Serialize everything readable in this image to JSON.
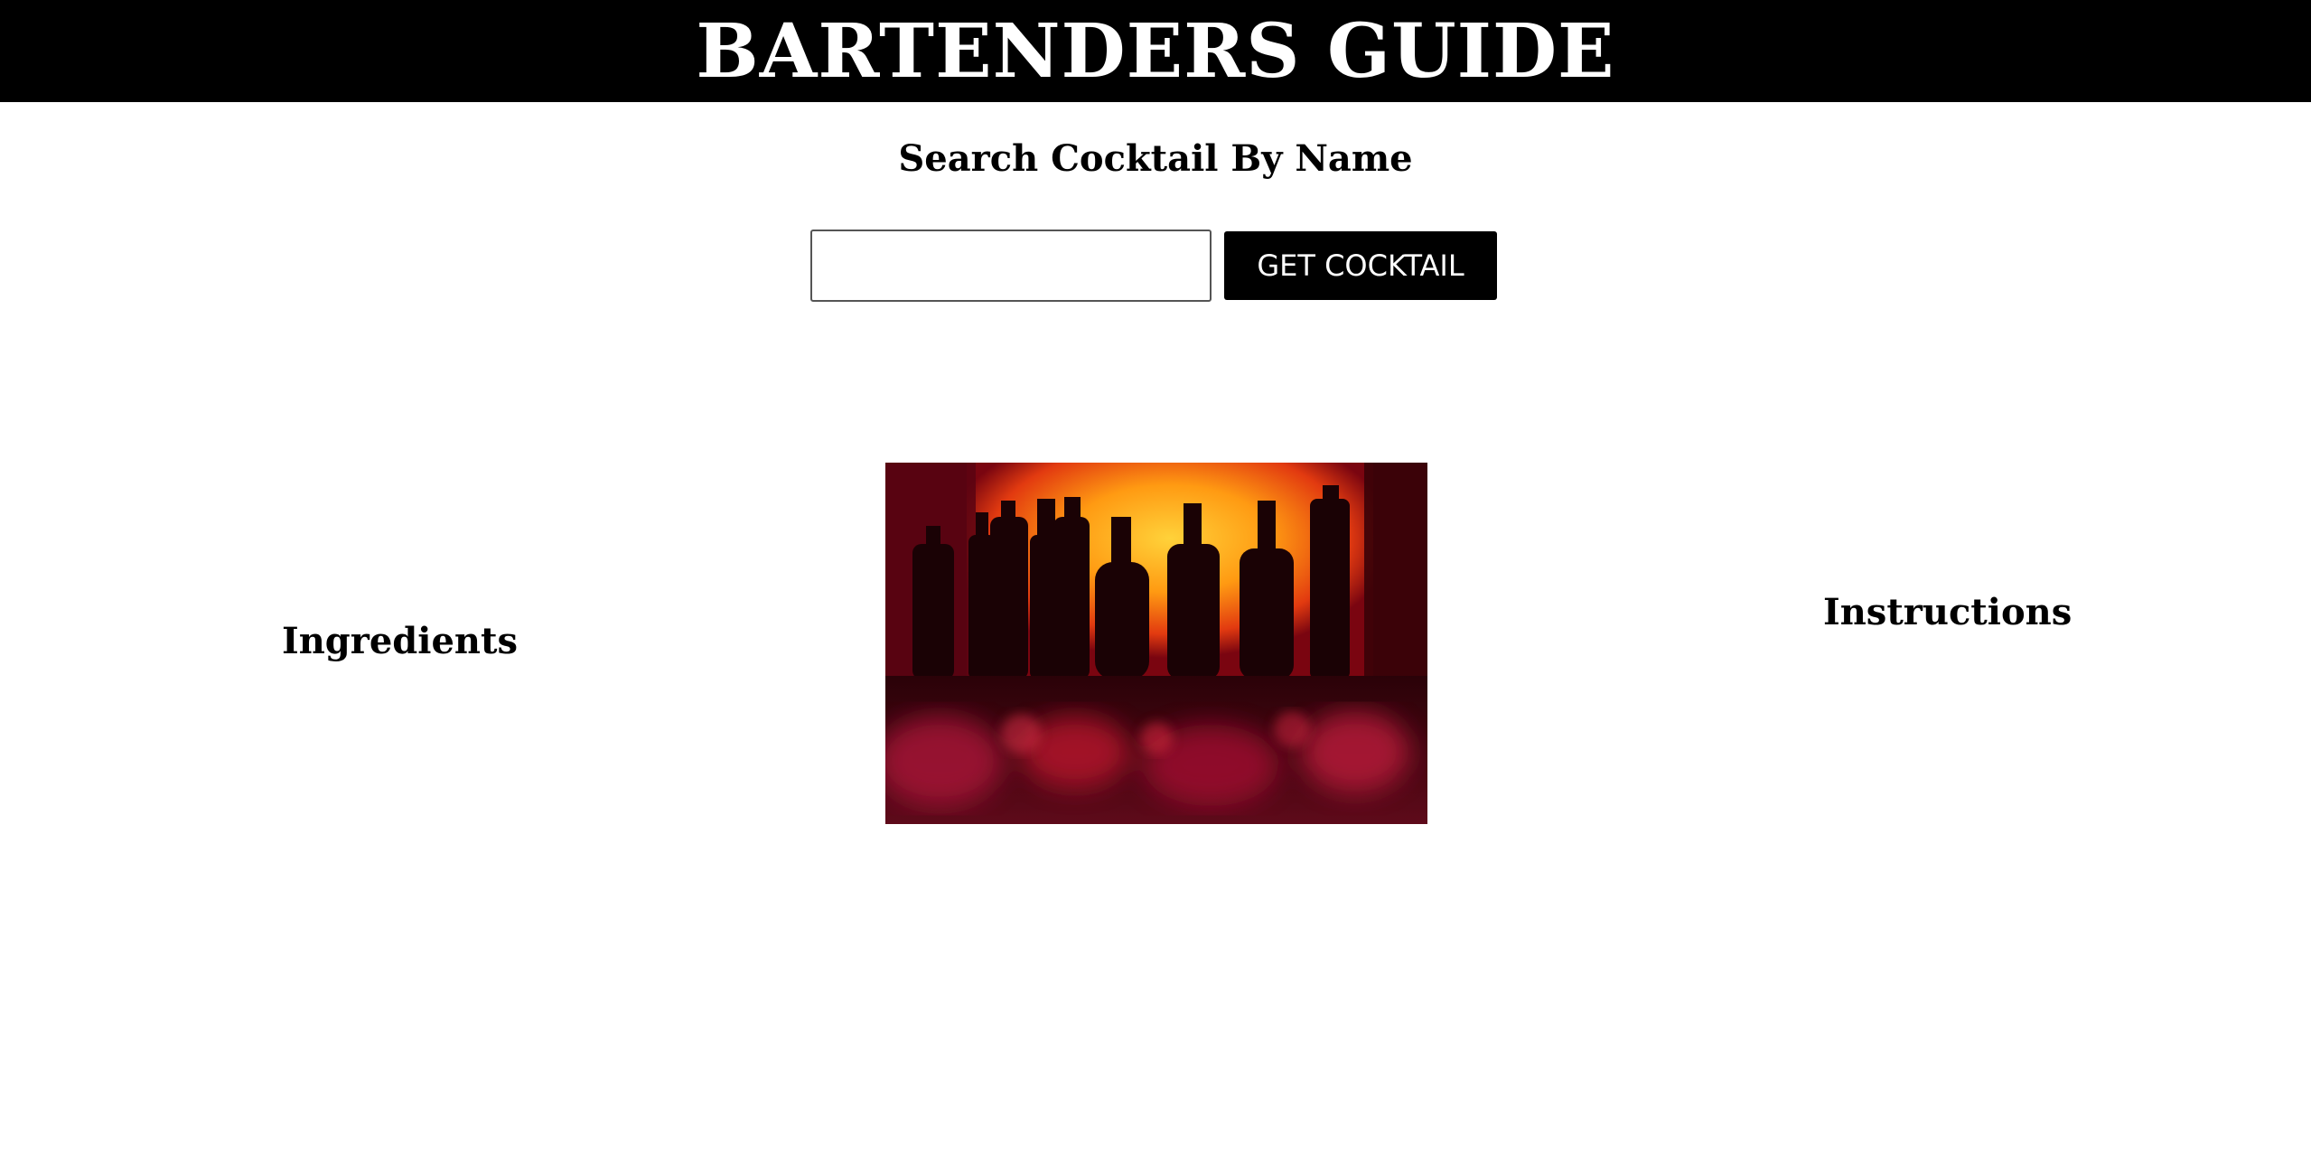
{
  "header": {
    "title": "BARTENDERS GUIDE"
  },
  "search": {
    "heading": "Search Cocktail By Name",
    "input_value": "",
    "placeholder": "",
    "button_label": "GET COCKTAIL"
  },
  "results": {
    "ingredients_heading": "Ingredients",
    "instructions_heading": "Instructions",
    "image_alt": "bottles on a bar shelf"
  },
  "colors": {
    "header_bg": "#000000",
    "button_bg": "#000000",
    "text": "#000000"
  }
}
